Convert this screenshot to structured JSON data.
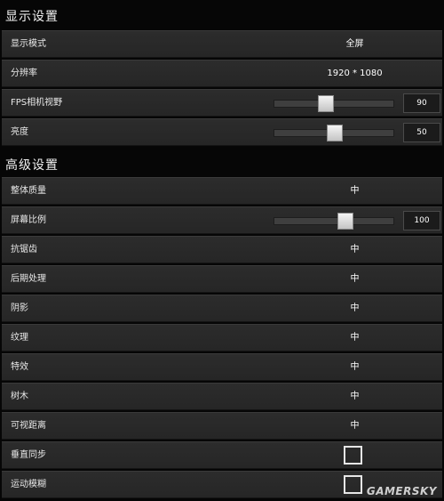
{
  "display_section": {
    "title": "显示设置",
    "rows": {
      "display_mode": {
        "label": "显示模式",
        "value": "全屏"
      },
      "resolution": {
        "label": "分辨率",
        "value": "1920 * 1080"
      },
      "fov": {
        "label": "FPS相机视野",
        "value": "90",
        "fill": 0.43
      },
      "brightness": {
        "label": "亮度",
        "value": "50",
        "fill": 0.5
      }
    }
  },
  "advanced_section": {
    "title": "高级设置",
    "rows": {
      "overall_quality": {
        "label": "整体质量",
        "value": "中"
      },
      "screen_scale": {
        "label": "屏幕比例",
        "value": "100",
        "fill": 0.59
      },
      "anti_aliasing": {
        "label": "抗锯齿",
        "value": "中"
      },
      "post_processing": {
        "label": "后期处理",
        "value": "中"
      },
      "shadows": {
        "label": "阴影",
        "value": "中"
      },
      "textures": {
        "label": "纹理",
        "value": "中"
      },
      "effects": {
        "label": "特效",
        "value": "中"
      },
      "foliage": {
        "label": "树木",
        "value": "中"
      },
      "view_distance": {
        "label": "可视距离",
        "value": "中"
      },
      "vsync": {
        "label": "垂直同步",
        "checked": false
      },
      "motion_blur": {
        "label": "运动模糊",
        "checked": false
      }
    }
  },
  "watermark": "GAMERSKY"
}
